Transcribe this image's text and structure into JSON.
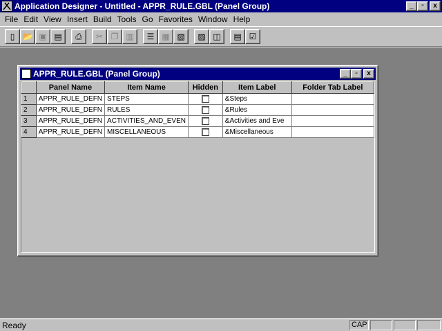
{
  "app": {
    "title": "Application Designer - Untitled - APPR_RULE.GBL (Panel Group)",
    "minimize": "_",
    "restore": "▫",
    "close": "x"
  },
  "menu": [
    "File",
    "Edit",
    "View",
    "Insert",
    "Build",
    "Tools",
    "Go",
    "Favorites",
    "Window",
    "Help"
  ],
  "toolbar": {
    "buttons": [
      {
        "name": "new-icon",
        "glyph": "▯"
      },
      {
        "name": "open-icon",
        "glyph": "📂"
      },
      {
        "name": "save-icon",
        "glyph": "▣"
      },
      {
        "name": "save-all-icon",
        "glyph": "▤"
      },
      {
        "name": "print-icon",
        "glyph": "⎙"
      },
      {
        "name": "cut-icon",
        "glyph": "✂"
      },
      {
        "name": "copy-icon",
        "glyph": "❐"
      },
      {
        "name": "paste-icon",
        "glyph": "▥"
      },
      {
        "name": "properties-icon",
        "glyph": "☰"
      },
      {
        "name": "project-icon",
        "glyph": "▦"
      },
      {
        "name": "find-icon",
        "glyph": "▧"
      },
      {
        "name": "insert-icon",
        "glyph": "▨"
      },
      {
        "name": "validate-icon",
        "glyph": "◫"
      },
      {
        "name": "panel-icon",
        "glyph": "▤"
      },
      {
        "name": "checkbox-icon",
        "glyph": "☑"
      }
    ]
  },
  "child": {
    "title": "APPR_RULE.GBL (Panel Group)",
    "columns": [
      "Panel Name",
      "Item Name",
      "Hidden",
      "Item Label",
      "Folder Tab Label"
    ],
    "rows": [
      {
        "num": "1",
        "panel": "APPR_RULE_DEFN",
        "item": "STEPS",
        "label": "&Steps",
        "tab": ""
      },
      {
        "num": "2",
        "panel": "APPR_RULE_DEFN",
        "item": "RULES",
        "label": "&Rules",
        "tab": ""
      },
      {
        "num": "3",
        "panel": "APPR_RULE_DEFN",
        "item": "ACTIVITIES_AND_EVEN",
        "label": "&Activities and Eve",
        "tab": ""
      },
      {
        "num": "4",
        "panel": "APPR_RULE_DEFN",
        "item": "MISCELLANEOUS",
        "label": "&Miscellaneous",
        "tab": ""
      }
    ]
  },
  "status": {
    "text": "Ready",
    "cap": "CAP"
  }
}
